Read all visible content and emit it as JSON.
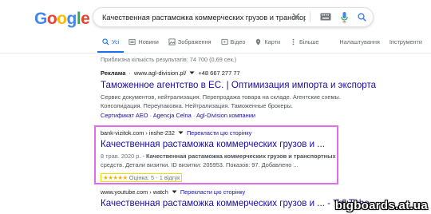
{
  "logo": {
    "text": "Google",
    "letters": [
      "G",
      "o",
      "o",
      "g",
      "l",
      "e"
    ]
  },
  "search": {
    "query": "Качественная растаможка коммерческих грузов и транспортных ср",
    "icons": [
      "keyboard-icon",
      "mic-icon",
      "search-icon"
    ]
  },
  "tabs": [
    {
      "label": "Усі",
      "icon": "search-icon",
      "active": true
    },
    {
      "label": "Новини",
      "icon": "news-icon"
    },
    {
      "label": "Зображення",
      "icon": "image-icon"
    },
    {
      "label": "Відео",
      "icon": "video-icon"
    },
    {
      "label": "Карти",
      "icon": "map-pin-icon"
    },
    {
      "label": "Більше",
      "icon": "more-icon"
    },
    {
      "label": "Налаштування"
    },
    {
      "label": "Інструменти"
    }
  ],
  "stats": "Приблизна кількість результатів: 74 700 (0,69 сек.)",
  "ad": {
    "badge": "Реклама",
    "url": "www.agl-division.pl/",
    "phone": "+48 667 277 77",
    "title": "Таможенное агентство в ЕС. | Оптимизация импорта и экспорта",
    "snippet1": "Сервис документов, нейтрализация. Перепродажа товара на складе. Агентские схемы.",
    "snippet2": "Консолидация. Переупаковка. Нейтрализация. Таможенные брокеры.",
    "links": [
      "Сертификат AEO",
      "Agencja Celna",
      "Agl-Division компании"
    ]
  },
  "result1": {
    "url": "bank-vizitok.com › inshe-232",
    "translate": "Перекласти цю сторінку",
    "title": "Качественная растаможка коммерческих грузов и ...",
    "date": "8 трав. 2020 р.",
    "snippet1": "Качественная растаможка коммерческих грузов и транспортных",
    "snippet2": "средств. Детали визитки. ID визитки: 205953. Показов: 97. Добавлено ...",
    "stars": "★★★★★",
    "rating": "Оцінка: 5 - 1 відгук"
  },
  "result2": {
    "url": "www.youtube.com › watch",
    "translate": "Перекласти цю сторінку",
    "title": "Качественная растаможка коммерческих грузов и ... - YouTube"
  },
  "watermark": "bigboards.at.ua",
  "colors": {
    "link": "#1a0dab",
    "accent": "#1a73e8",
    "highlight": "#e26be8",
    "rating_box": "#e8e000"
  }
}
